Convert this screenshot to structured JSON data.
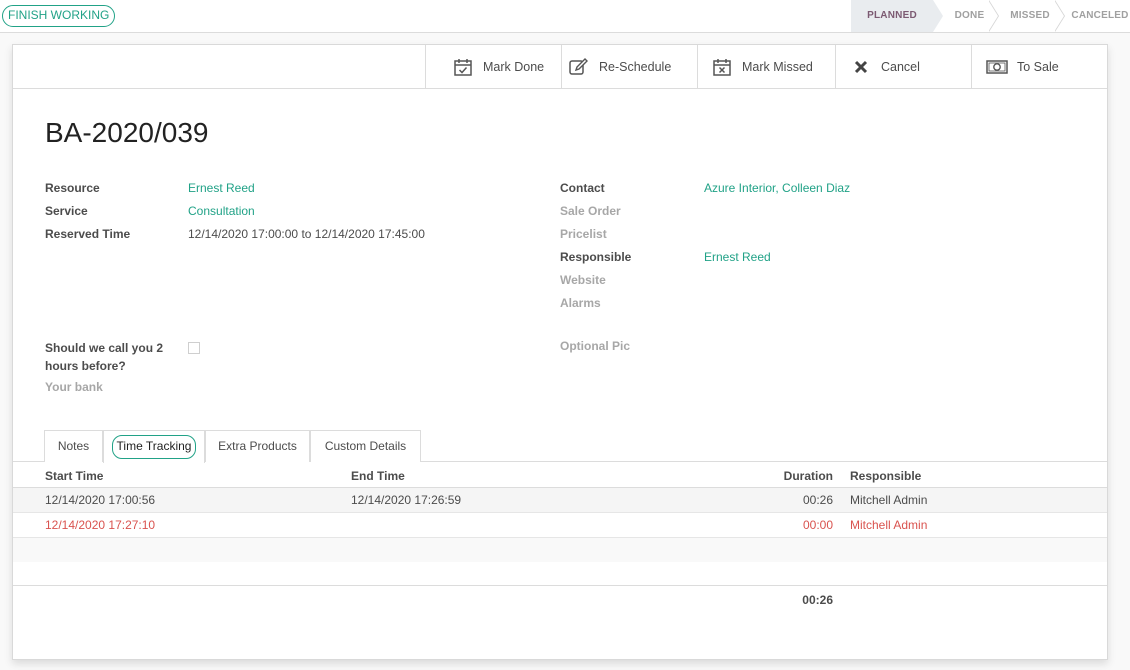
{
  "statusbar": {
    "finish_label": "FINISH WORKING",
    "stages": [
      "PLANNED",
      "DONE",
      "MISSED",
      "CANCELED"
    ],
    "active_stage": "PLANNED"
  },
  "buttons": {
    "mark_done": "Mark Done",
    "reschedule": "Re-Schedule",
    "mark_missed": "Mark Missed",
    "cancel": "Cancel",
    "to_sale": "To Sale"
  },
  "record": {
    "title": "BA-2020/039"
  },
  "left_fields": {
    "resource_label": "Resource",
    "resource_value": "Ernest Reed",
    "service_label": "Service",
    "service_value": "Consultation",
    "reserved_label": "Reserved Time",
    "reserved_value": "12/14/2020 17:00:00 to 12/14/2020 17:45:00",
    "call_label_line1": "Should we call you 2",
    "call_label_line2": "hours before?",
    "bank_label": "Your bank"
  },
  "right_fields": {
    "contact_label": "Contact",
    "contact_value": "Azure Interior, Colleen Diaz",
    "sale_order_label": "Sale Order",
    "pricelist_label": "Pricelist",
    "responsible_label": "Responsible",
    "responsible_value": "Ernest Reed",
    "website_label": "Website",
    "alarms_label": "Alarms",
    "optional_pic_label": "Optional Pic"
  },
  "tabs": [
    "Notes",
    "Time Tracking",
    "Extra Products",
    "Custom Details"
  ],
  "active_tab": "Time Tracking",
  "time_table": {
    "columns": [
      "Start Time",
      "End Time",
      "Duration",
      "Responsible"
    ],
    "rows": [
      {
        "start": "12/14/2020 17:00:56",
        "end": "12/14/2020 17:26:59",
        "duration": "00:26",
        "responsible": "Mitchell Admin"
      },
      {
        "start": "12/14/2020 17:27:10",
        "end": "",
        "duration": "00:00",
        "responsible": "Mitchell Admin"
      }
    ],
    "total_duration": "00:26"
  },
  "colors": {
    "accent": "#21a287",
    "running_row": "#d9534f",
    "active_stage": "#7c5a72"
  }
}
